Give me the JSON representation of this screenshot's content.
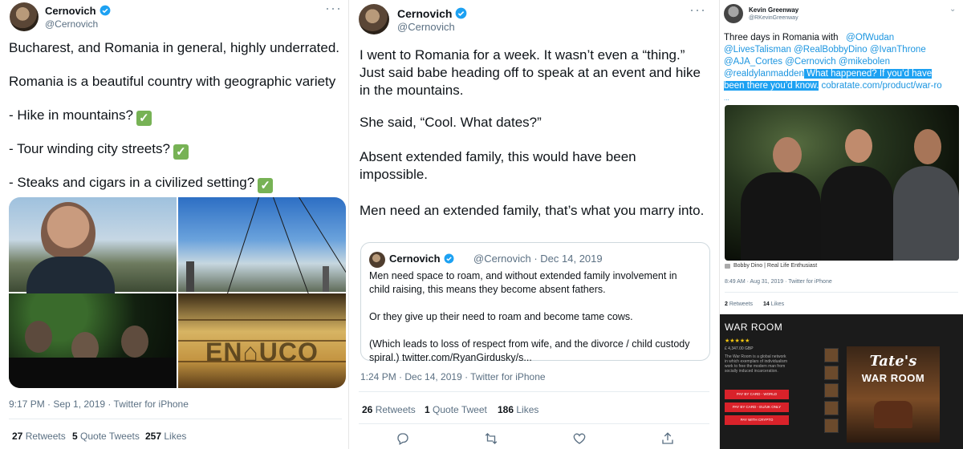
{
  "tweet1": {
    "name": "Cernovich",
    "handle": "@Cernovich",
    "line1": "Bucharest, and Romania in general, highly underrated.",
    "line2": "Romania is a beautiful country with geographic variety",
    "line3": "- Hike in mountains?",
    "line4": "- Tour winding city streets?",
    "line5": "- Steaks and cigars in a civilized setting?",
    "check_glyph": "✓",
    "photo_overlay": "EN⌂UCO",
    "meta": "9:17 PM · Sep 1, 2019 · Twitter for iPhone",
    "retweets": "27",
    "retweets_label": "Retweets",
    "quotes": "5",
    "quotes_label": "Quote Tweets",
    "likes": "257",
    "likes_label": "Likes"
  },
  "tweet2": {
    "name": "Cernovich",
    "handle": "@Cernovich",
    "para1": "I went to Romania for a week. It wasn’t even a “thing.” Just said babe heading off to speak at an event and hike in the mountains.",
    "para2": "She said, “Cool. What dates?”",
    "para3": "Absent extended family, this would have been impossible.",
    "para4": "Men need an extended family, that’s what you marry into.",
    "quote": {
      "name": "Cernovich",
      "handle": "@Cernovich · Dec 14, 2019",
      "text": "Men need space to roam, and without extended family involvement in child raising, this means they become absent fathers.\n\nOr they give up their need to roam and become tame cows.\n\n(Which leads to loss of respect from wife, and the divorce / child custody spiral.) twitter.com/RyanGirdusky/s..."
    },
    "meta": "1:24 PM · Dec 14, 2019 · Twitter for iPhone",
    "retweets": "26",
    "retweets_label": "Retweets",
    "quotes": "1",
    "quotes_label": "Quote Tweet",
    "likes": "186",
    "likes_label": "Likes"
  },
  "tweet3": {
    "name": "Kevin Greenway",
    "handle": "@RKevinGreenway",
    "text_start": "Three days in Romania with",
    "mention1": "@OfWudan",
    "mention2": "@LivesTalisman @RealBobbyDino @IvanThrone",
    "mention3": "@AJA_Cortes @Cernovich @mikebolen",
    "mention4": "@realdylanmadden",
    "highlight1": " What happened? If you’d have",
    "highlight2": "been there you’d know.",
    "link": " cobratate.com/product/war-ro",
    "ellipsis": "...",
    "caption": "Bobby Dino | Real Life Enthusiast",
    "meta": "8:49 AM · Aug 31, 2019 · Twitter for iPhone",
    "retweets": "2",
    "retweets_label": "Retweets",
    "likes": "14",
    "likes_label": "Likes"
  },
  "warroom": {
    "title": "WAR ROOM",
    "stars": "★★★★★",
    "price": "£ 4,347.00 GBP",
    "desc": "The War Room is a global network\nin which exemplars of individualism\nwork to free the modern man from\nsocially induced incarceration.",
    "btn1": "PAY BY CARD - WORLD",
    "btn2": "PAY BY CARD - EU/UK ONLY",
    "btn3": "PAY WITH CRYPTO",
    "poster_tate": "Tate's",
    "poster_title": "WAR ROOM"
  },
  "colors": {
    "accent": "#1da1f2",
    "verified": "#1da1f2",
    "check": "#77b255",
    "warroom_red": "#d9222a"
  },
  "icons": [
    "reply-icon",
    "retweet-icon",
    "like-icon",
    "share-icon",
    "more-icon",
    "verified-icon"
  ]
}
